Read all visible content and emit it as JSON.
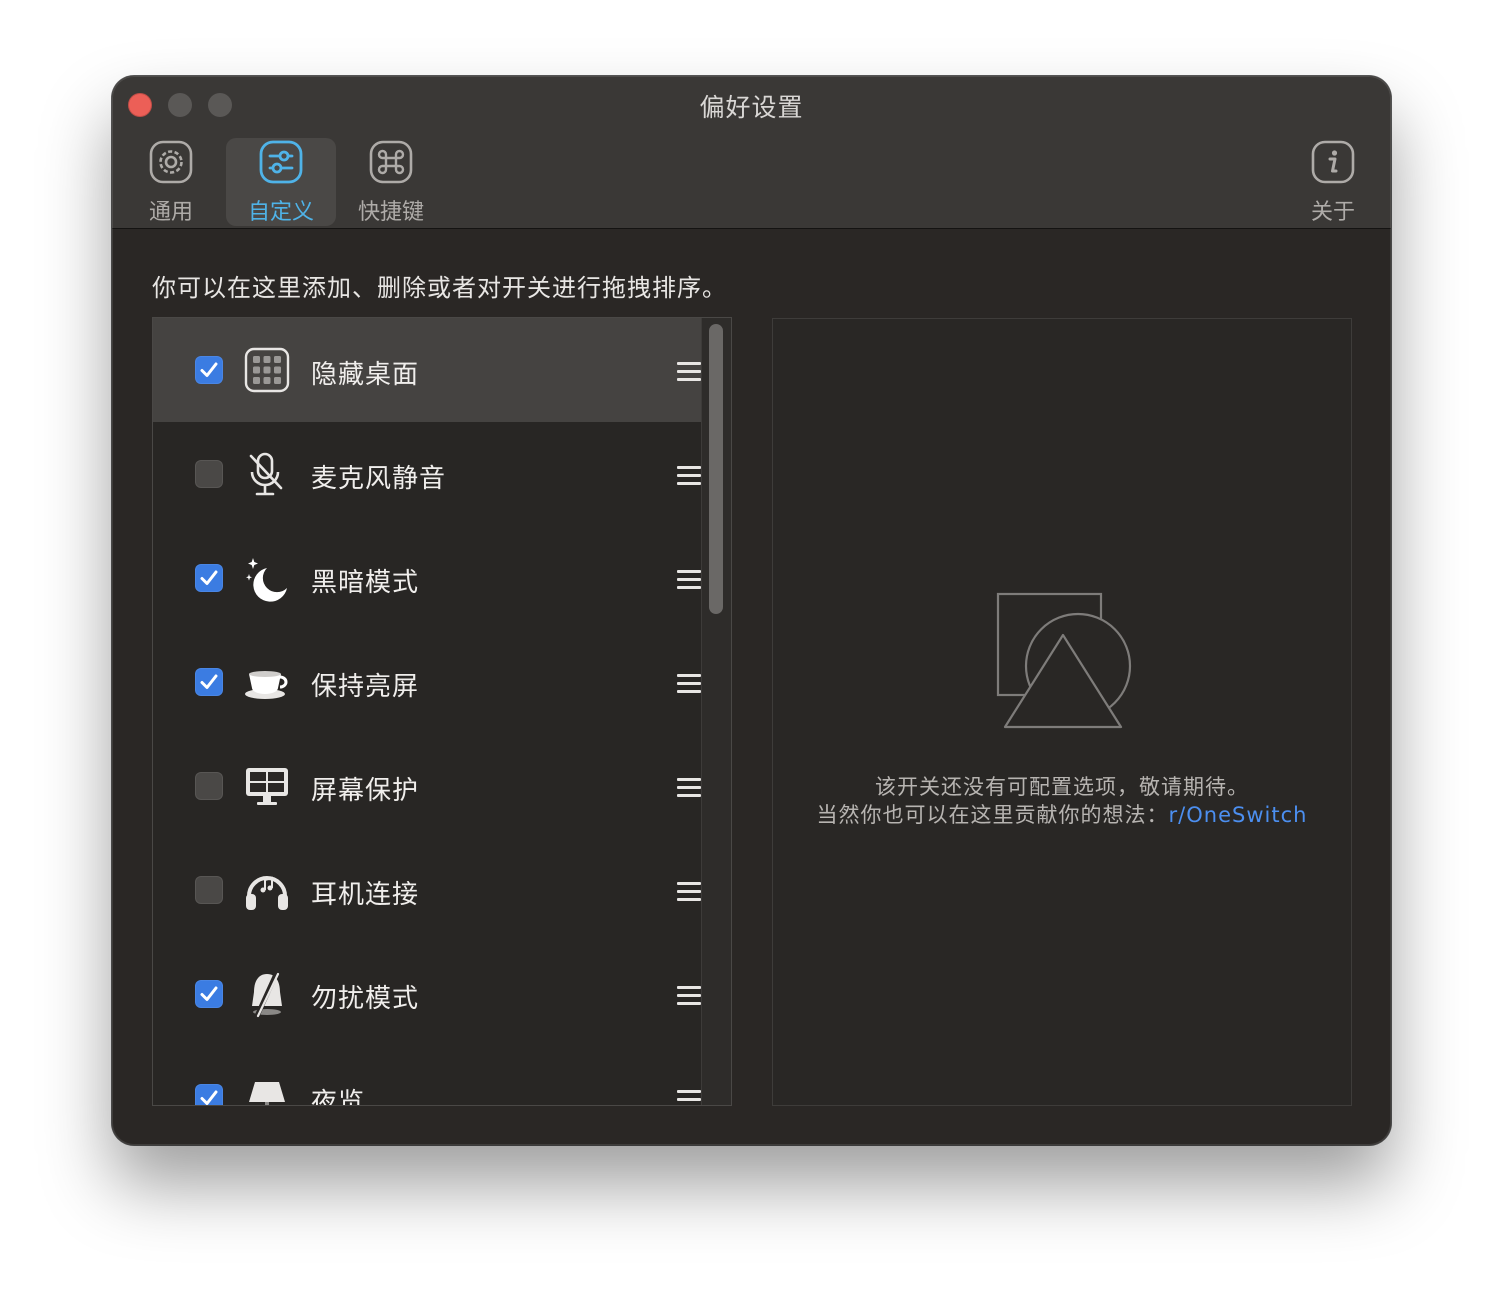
{
  "window": {
    "title": "偏好设置"
  },
  "toolbar": {
    "tabs": [
      {
        "label": "通用",
        "icon": "gear-icon"
      },
      {
        "label": "自定义",
        "icon": "sliders-icon",
        "active": true
      },
      {
        "label": "快捷键",
        "icon": "command-icon"
      },
      {
        "label": "关于",
        "icon": "info-icon"
      }
    ]
  },
  "content": {
    "hint": "你可以在这里添加、删除或者对开关进行拖拽排序。",
    "items": [
      {
        "label": "隐藏桌面",
        "checked": true,
        "icon": "grid-icon",
        "selected": true
      },
      {
        "label": "麦克风静音",
        "checked": false,
        "icon": "mic-muted-icon"
      },
      {
        "label": "黑暗模式",
        "checked": true,
        "icon": "moon-icon"
      },
      {
        "label": "保持亮屏",
        "checked": true,
        "icon": "coffee-cup-icon"
      },
      {
        "label": "屏幕保护",
        "checked": false,
        "icon": "monitor-icon"
      },
      {
        "label": "耳机连接",
        "checked": false,
        "icon": "headphones-icon"
      },
      {
        "label": "勿扰模式",
        "checked": true,
        "icon": "bell-slash-icon"
      },
      {
        "label": "夜览",
        "checked": true,
        "icon": "lamp-icon"
      }
    ],
    "detail": {
      "message_line1": "该开关还没有可配置选项，敬请期待。",
      "message_line2_prefix": "当然你也可以在这里贡献你的想法：",
      "link_text": "r/OneSwitch"
    }
  },
  "colors": {
    "accent": "#4fb3e8",
    "checkbox_checked": "#3b7ce2",
    "link": "#4c8ff0",
    "close_button": "#ec5f57"
  }
}
